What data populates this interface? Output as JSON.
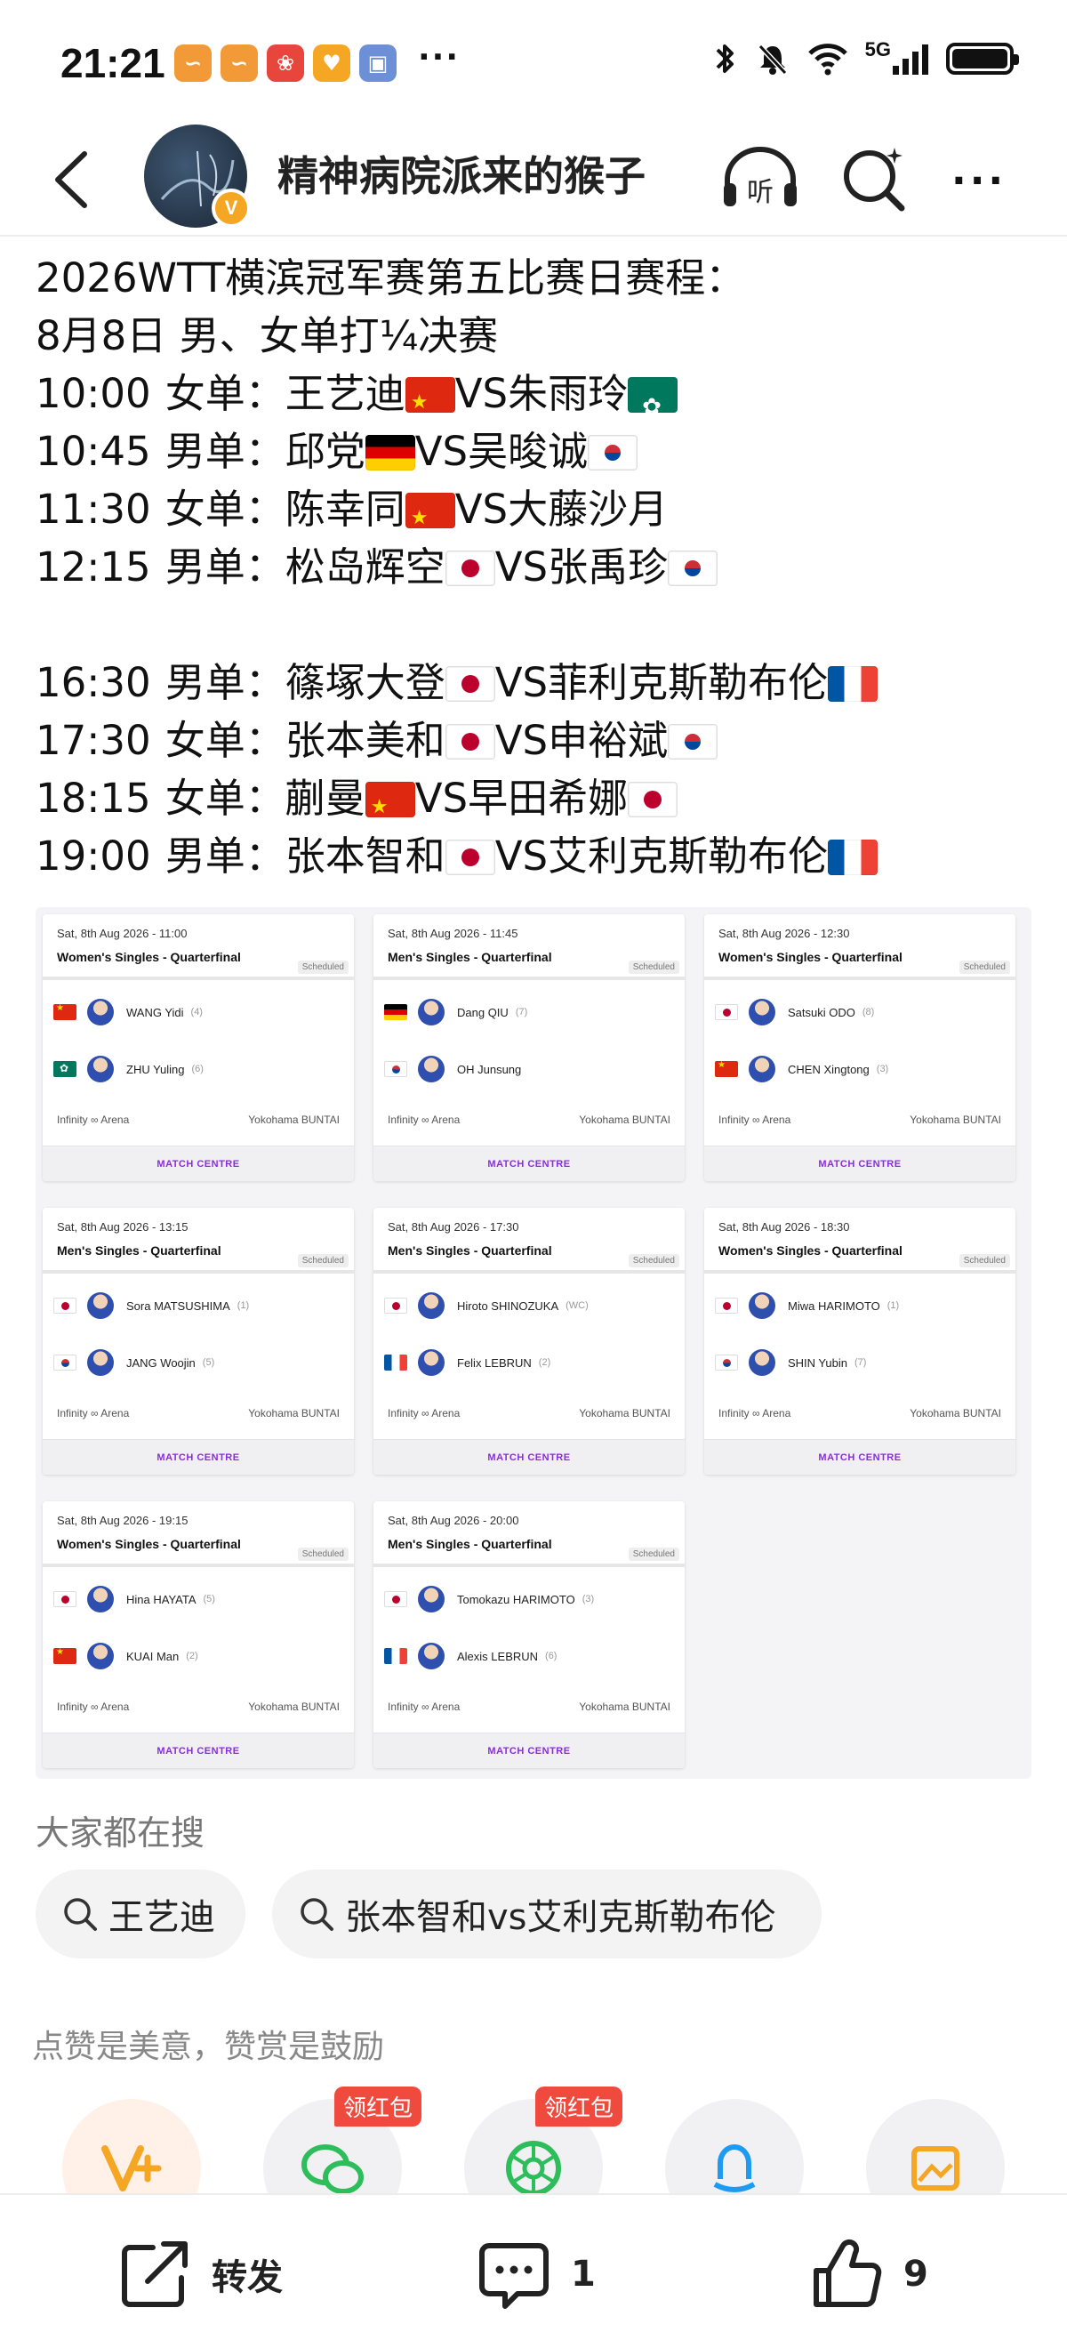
{
  "status_bar": {
    "time": "21:21",
    "more": "···",
    "network": "5G"
  },
  "nav": {
    "username": "精神病院派来的猴子",
    "verified_badge": "V"
  },
  "post": {
    "lines": [
      "2026WTT横滨冠军赛第五比赛日赛程：",
      "8月8日 男、女单打¼决赛"
    ],
    "matches_block1": [
      {
        "time": "10:00",
        "event": "女单：",
        "p1": "王艺迪",
        "p1_flag": "cn",
        "vs": "VS",
        "p2": "朱雨玲",
        "p2_flag": "mo"
      },
      {
        "time": "10:45",
        "event": "男单：",
        "p1": "邱党",
        "p1_flag": "de",
        "vs": "VS",
        "p2": "吴晙诚",
        "p2_flag": "kr"
      },
      {
        "time": "11:30",
        "event": "女单：",
        "p1": "陈幸同",
        "p1_flag": "cn",
        "vs": "VS",
        "p2": "大藤沙月",
        "p2_flag": ""
      },
      {
        "time": "12:15",
        "event": "男单：",
        "p1": "松岛辉空",
        "p1_flag": "jp",
        "vs": "VS",
        "p2": "张禹珍",
        "p2_flag": "kr"
      }
    ],
    "matches_block2": [
      {
        "time": "16:30",
        "event": "男单：",
        "p1": "篠塚大登",
        "p1_flag": "jp",
        "vs": "VS",
        "p2": "菲利克斯勒布伦",
        "p2_flag": "fr"
      },
      {
        "time": "17:30",
        "event": "女单：",
        "p1": "张本美和",
        "p1_flag": "jp",
        "vs": "VS",
        "p2": "申裕斌",
        "p2_flag": "kr"
      },
      {
        "time": "18:15",
        "event": "女单：",
        "p1": "蒯曼",
        "p1_flag": "cn",
        "vs": "VS",
        "p2": "早田希娜",
        "p2_flag": "jp"
      },
      {
        "time": "19:00",
        "event": "男单：",
        "p1": "张本智和",
        "p1_flag": "jp",
        "vs": "VS",
        "p2": "艾利克斯勒布伦",
        "p2_flag": "fr"
      }
    ]
  },
  "cards": [
    {
      "date": "Sat, 8th Aug 2026 - 11:00",
      "event": "Women's Singles - Quarterfinal",
      "status": "Scheduled",
      "p1": {
        "flag": "cn",
        "name": "WANG Yidi",
        "seed": "(4)"
      },
      "p2": {
        "flag": "mo",
        "name": "ZHU Yuling",
        "seed": "(6)"
      },
      "venue": "Infinity ∞ Arena",
      "city": "Yokohama BUNTAI",
      "button": "MATCH CENTRE"
    },
    {
      "date": "Sat, 8th Aug 2026 - 11:45",
      "event": "Men's Singles - Quarterfinal",
      "status": "Scheduled",
      "p1": {
        "flag": "de",
        "name": "Dang QIU",
        "seed": "(7)"
      },
      "p2": {
        "flag": "kr",
        "name": "OH Junsung",
        "seed": ""
      },
      "venue": "Infinity ∞ Arena",
      "city": "Yokohama BUNTAI",
      "button": "MATCH CENTRE"
    },
    {
      "date": "Sat, 8th Aug 2026 - 12:30",
      "event": "Women's Singles - Quarterfinal",
      "status": "Scheduled",
      "p1": {
        "flag": "jp",
        "name": "Satsuki ODO",
        "seed": "(8)"
      },
      "p2": {
        "flag": "cn",
        "name": "CHEN Xingtong",
        "seed": "(3)"
      },
      "venue": "Infinity ∞ Arena",
      "city": "Yokohama BUNTAI",
      "button": "MATCH CENTRE"
    },
    {
      "date": "Sat, 8th Aug 2026 - 13:15",
      "event": "Men's Singles - Quarterfinal",
      "status": "Scheduled",
      "p1": {
        "flag": "jp",
        "name": "Sora MATSUSHIMA",
        "seed": "(1)"
      },
      "p2": {
        "flag": "kr",
        "name": "JANG Woojin",
        "seed": "(5)"
      },
      "venue": "Infinity ∞ Arena",
      "city": "Yokohama BUNTAI",
      "button": "MATCH CENTRE"
    },
    {
      "date": "Sat, 8th Aug 2026 - 17:30",
      "event": "Men's Singles - Quarterfinal",
      "status": "Scheduled",
      "p1": {
        "flag": "jp",
        "name": "Hiroto SHINOZUKA",
        "seed": "(WC)"
      },
      "p2": {
        "flag": "fr",
        "name": "Felix LEBRUN",
        "seed": "(2)"
      },
      "venue": "Infinity ∞ Arena",
      "city": "Yokohama BUNTAI",
      "button": "MATCH CENTRE"
    },
    {
      "date": "Sat, 8th Aug 2026 - 18:30",
      "event": "Women's Singles - Quarterfinal",
      "status": "Scheduled",
      "p1": {
        "flag": "jp",
        "name": "Miwa HARIMOTO",
        "seed": "(1)"
      },
      "p2": {
        "flag": "kr",
        "name": "SHIN Yubin",
        "seed": "(7)"
      },
      "venue": "Infinity ∞ Arena",
      "city": "Yokohama BUNTAI",
      "button": "MATCH CENTRE"
    },
    {
      "date": "Sat, 8th Aug 2026 - 19:15",
      "event": "Women's Singles - Quarterfinal",
      "status": "Scheduled",
      "p1": {
        "flag": "jp",
        "name": "Hina HAYATA",
        "seed": "(5)"
      },
      "p2": {
        "flag": "cn",
        "name": "KUAI Man",
        "seed": "(2)"
      },
      "venue": "Infinity ∞ Arena",
      "city": "Yokohama BUNTAI",
      "button": "MATCH CENTRE"
    },
    {
      "date": "Sat, 8th Aug 2026 - 20:00",
      "event": "Men's Singles - Quarterfinal",
      "status": "Scheduled",
      "p1": {
        "flag": "jp",
        "name": "Tomokazu HARIMOTO",
        "seed": "(3)"
      },
      "p2": {
        "flag": "fr",
        "name": "Alexis LEBRUN",
        "seed": "(6)"
      },
      "venue": "Infinity ∞ Arena",
      "city": "Yokohama BUNTAI",
      "button": "MATCH CENTRE"
    }
  ],
  "searches": {
    "title": "大家都在搜",
    "chips": [
      "王艺迪",
      "张本智和vs艾利克斯勒布伦"
    ]
  },
  "reward": {
    "title": "点赞是美意，赞赏是鼓励",
    "badge": "领红包"
  },
  "bottom": {
    "share": "转发",
    "comments": "1",
    "likes": "9"
  },
  "colors": {
    "accent_orange": "#f5a623",
    "badge_red": "#f04a3e",
    "match_centre_purple": "#8a2be2"
  }
}
